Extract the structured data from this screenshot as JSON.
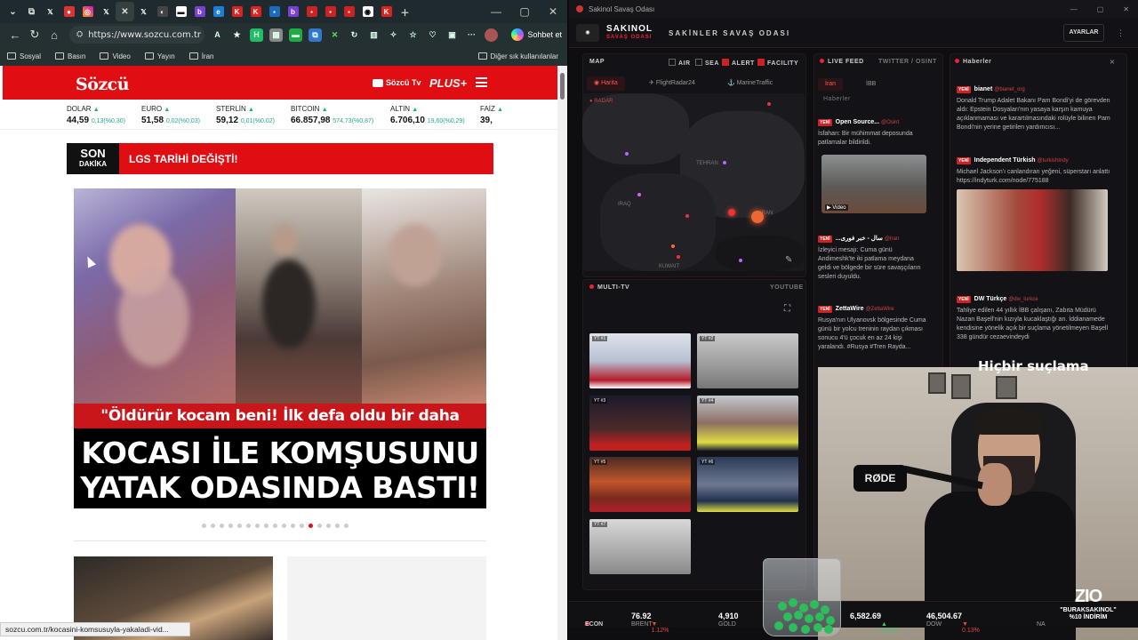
{
  "browser": {
    "url": "https://www.sozcu.com.tr",
    "copilot_label": "Sohbet et",
    "bookmarks": [
      "Sosyal",
      "Basın",
      "Video",
      "Yayın",
      "İran"
    ],
    "bookmarks_other": "Diğer sık kullanılanlar",
    "status_url": "sozcu.com.tr/kocasini-komsusuyla-yakaladi-vid..."
  },
  "site": {
    "logo": "Sözcü",
    "tv_label": "Sözcü Tv",
    "plus_label": "PLUS+",
    "ticker": [
      {
        "name": "DOLAR",
        "value": "44,59",
        "change": "0,13(%0,30)"
      },
      {
        "name": "EURO",
        "value": "51,58",
        "change": "0,02(%0,03)"
      },
      {
        "name": "STERLİN",
        "value": "59,12",
        "change": "0,01(%0,02)"
      },
      {
        "name": "BITCOIN",
        "value": "66.857,98",
        "change": "574,73(%0,87)"
      },
      {
        "name": "ALTIN",
        "value": "6.706,10",
        "change": "19,60(%0,29)"
      },
      {
        "name": "FAİZ",
        "value": "39,",
        "change": ""
      }
    ],
    "breaking_son": "SON",
    "breaking_dakika": "DAKİKA",
    "breaking_text": "LGS TARİHİ DEĞİŞTİ!",
    "quote": "\"Öldürür kocam beni! İlk defa oldu bir daha olmayacak!\"",
    "headline_line1": "KOCASI İLE KOMŞUSUNU",
    "headline_line2": "YATAK ODASINDA BASTI!",
    "slider_total": 17,
    "slider_active": 13
  },
  "app": {
    "window_title": "Sakinol Savaş Odası",
    "brand": "SAKINOL",
    "brand_sub": "SAVAŞ ODASI",
    "title": "SAKİNLER SAVAŞ ODASI",
    "settings": "AYARLAR",
    "map_label": "MAP",
    "map_filters": [
      {
        "label": "AIR",
        "on": false
      },
      {
        "label": "SEA",
        "on": false
      },
      {
        "label": "ALERT",
        "on": true
      },
      {
        "label": "FACILITY",
        "on": true
      }
    ],
    "map_tabs": [
      "Harita",
      "FlightRadar24",
      "MarineTraffic"
    ],
    "radar_label": "RADAR",
    "map_places": [
      "TEHRAN",
      "IRAQ",
      "IRAN",
      "KUWAIT"
    ],
    "multitv_label": "MULTI-TV",
    "youtube_label": "YOUTUBE",
    "tv_labels": [
      "YT #1",
      "YT #2",
      "YT #3",
      "YT #4",
      "YT #5",
      "YT #6",
      "YT #7"
    ],
    "live_feed_label": "LIVE FEED",
    "live_feed_sub": "TWITTER / OSINT",
    "feed_tabs": [
      "İran",
      "İBB"
    ],
    "feed_subtab": "Haberler",
    "feed": [
      {
        "badge": "YENİ",
        "source": "Open Source...",
        "handle": "@Osint",
        "text": "İsfahan: Bir mühimmat deposunda patlamalar bildirildi.",
        "video": "Video"
      },
      {
        "badge": "YENİ",
        "source": "...سال - خبر فوری",
        "handle": "@Iran",
        "text": "İzleyici mesajı: Cuma günü Andimeshk'te iki patlama meydana geldi ve bölgede bir süre savaşçıların sesleri duyuldu."
      },
      {
        "badge": "YENİ",
        "source": "ZettaWire",
        "handle": "@ZettaWire",
        "text": "Rusya'nın Ulyanovsk bölgesinde Cuma günü bir yolcu treninin raydan çıkması sonucu 4'ü çocuk en az 24 kişi yaralandı. #Rusya #Tren Rayda..."
      }
    ],
    "news_label": "Haberler",
    "news": [
      {
        "badge": "YENİ",
        "source": "bianet",
        "handle": "@bianet_org",
        "text": "Donald Trump Adalet Bakanı Pam Bondi'yi de görevden aldı: Epstein Dosyaları'nın yasaya karşın kamuya açıklanmaması ve karartılmasındaki rolüyle bilinen Pam Bondi'nin yerine getirilen yardımcısı..."
      },
      {
        "badge": "YENİ",
        "source": "Independent Türkish",
        "handle": "@turkishIndy",
        "text": "Michael Jackson'ı canlandıran yeğeni, süperstarı anlattı https://indyturk.com/node/775188"
      },
      {
        "badge": "YENİ",
        "source": "DW Türkçe",
        "handle": "@dw_turkce",
        "text": "Tahliye edilen 44 yıllık İBB çalışanı, Zabıta Müdürü Nazan Başell'nin kızıyla kucaklaştığı an. İddianamede kendisine yönelik açık bir suçlama yönetilmeyen Başell 338 gündür cezaevindeydi"
      }
    ],
    "overlay_caption": "Hiçbir suçlama",
    "econ_label": "ECON",
    "econ": [
      {
        "name": "BRENT",
        "value": "76.92",
        "change": "▼ 1.12%",
        "dir": "down"
      },
      {
        "name": "GOLD",
        "value": "4,910",
        "change": "",
        "dir": "up"
      },
      {
        "name": "",
        "value": "6,582.69",
        "change": "▲ 0.11%",
        "dir": "up"
      },
      {
        "name": "DOW",
        "value": "46,504.67",
        "change": "▼ 0.13%",
        "dir": "down"
      },
      {
        "name": "NA",
        "value": "",
        "change": "",
        "dir": ""
      }
    ]
  },
  "webcam": {
    "mic_brand": "RØDE",
    "promo_logo": "ZIO",
    "promo_code": "\"BURAKSAKINOL\"",
    "promo_discount": "%10 İNDİRİM"
  },
  "colors": {
    "sozcu_red": "#e00d13",
    "app_accent": "#e22233",
    "app_bg": "#0e0e11"
  }
}
